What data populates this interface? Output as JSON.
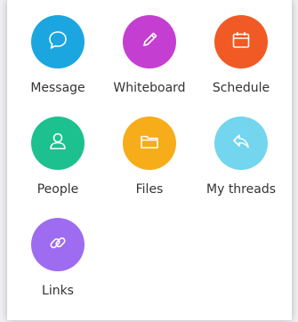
{
  "apps": [
    {
      "id": "message",
      "label": "Message",
      "color": "#1ba6df",
      "icon": "chat-bubble-icon"
    },
    {
      "id": "whiteboard",
      "label": "Whiteboard",
      "color": "#c43fd1",
      "icon": "pencil-icon"
    },
    {
      "id": "schedule",
      "label": "Schedule",
      "color": "#f15a24",
      "icon": "calendar-icon"
    },
    {
      "id": "people",
      "label": "People",
      "color": "#1cc18f",
      "icon": "person-icon"
    },
    {
      "id": "files",
      "label": "Files",
      "color": "#f7ac19",
      "icon": "folder-icon"
    },
    {
      "id": "threads",
      "label": "My threads",
      "color": "#73d5ee",
      "icon": "reply-arrow-icon"
    },
    {
      "id": "links",
      "label": "Links",
      "color": "#9d6cf0",
      "icon": "link-icon"
    }
  ]
}
